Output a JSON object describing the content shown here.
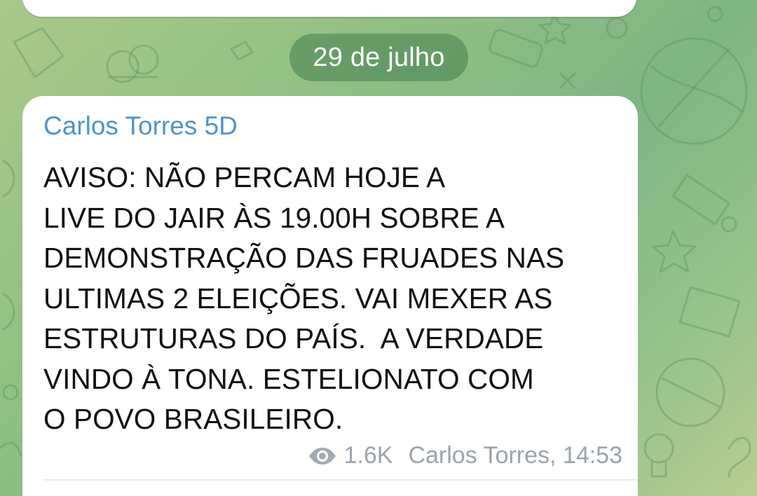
{
  "chat": {
    "date_separator": "29 de julho",
    "message": {
      "sender": "Carlos Torres 5D",
      "text": "AVISO: NÃO PERCAM HOJE A\nLIVE DO JAIR ÀS 19.00H SOBRE A\nDEMONSTRAÇÃO DAS FRUADES NAS\nULTIMAS 2 ELEIÇÕES. VAI MEXER AS\nESTRUTURAS DO PAÍS.  A VERDADE\nVINDO À TONA. ESTELIONATO COM\nO POVO BRASILEIRO.",
      "views": "1.6K",
      "signature_time": "Carlos Torres, 14:53",
      "views_icon": "eye-icon"
    }
  },
  "colors": {
    "sender_name": "#4f94c9",
    "meta_text": "#9ba3ab",
    "date_pill": "#568e5c",
    "bubble": "#ffffff"
  }
}
